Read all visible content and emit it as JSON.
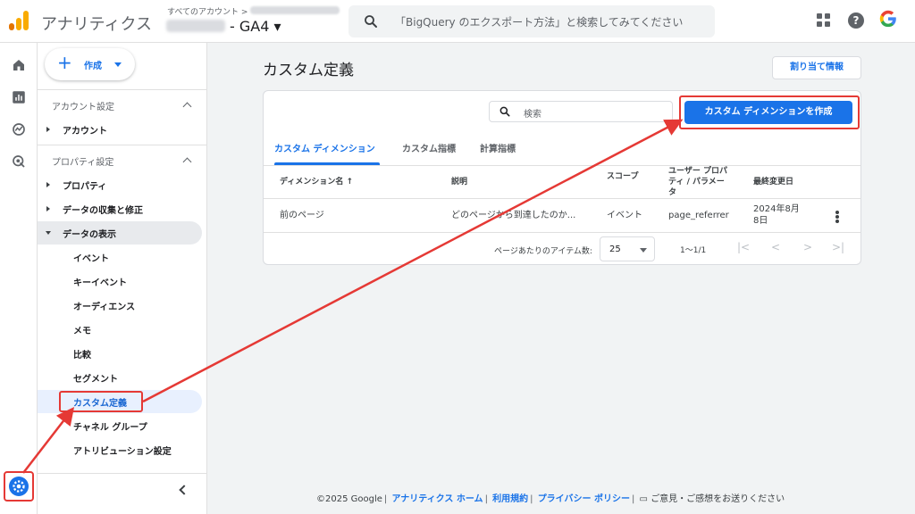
{
  "header": {
    "app_title": "アナリティクス",
    "account_crumb": "すべてのアカウント >",
    "property_name": "- GA4 ▾",
    "search_placeholder": "「BigQuery のエクスポート方法」と検索してみてください",
    "help_label": "?",
    "google_label": "G"
  },
  "rail": {
    "items": [
      "home-icon",
      "reports-icon",
      "explore-icon",
      "advertising-icon"
    ],
    "settings_icon": "gear-icon"
  },
  "sidebar": {
    "create_label": "作成",
    "create_plus": "+",
    "sections": [
      {
        "title": "アカウント設定",
        "items": [
          "アカウント"
        ]
      },
      {
        "title": "プロパティ設定",
        "items": [
          "プロパティ",
          "データの収集と修正",
          "データの表示"
        ]
      }
    ],
    "sub_items": [
      "イベント",
      "キーイベント",
      "オーディエンス",
      "メモ",
      "比較",
      "セグメント",
      "カスタム定義",
      "チャネル グループ",
      "アトリビューション設定"
    ]
  },
  "main": {
    "page_title": "カスタム定義",
    "attribution_button": "割り当て情報",
    "search_placeholder": "検索",
    "create_button": "カスタム ディメンションを作成",
    "tabs": [
      "カスタム ディメンション",
      "カスタム指標",
      "計算指標"
    ],
    "table": {
      "headers": [
        "ディメンション名 ↑",
        "説明",
        "スコープ",
        "ユーザー プロパティ / パラメータ",
        "最終変更日"
      ],
      "rows": [
        [
          "前のページ",
          "どのページから到達したのか...",
          "イベント",
          "page_referrer",
          "2024年8月8日"
        ]
      ]
    },
    "pager": {
      "items_per_page_label": "ページあたりのアイテム数:",
      "items_per_page": "25",
      "range": "1～1/1",
      "first": "|<",
      "prev": "<",
      "next": ">",
      "last": ">|"
    }
  },
  "footer": {
    "copyright": "©2025 Google",
    "links": [
      "アナリティクス ホーム",
      "利用規約",
      "プライバシー ポリシー"
    ],
    "feedback": "ご意見・ご感想をお送りください"
  },
  "colors": {
    "accent": "#1a73e8",
    "annotation": "#e53935"
  }
}
